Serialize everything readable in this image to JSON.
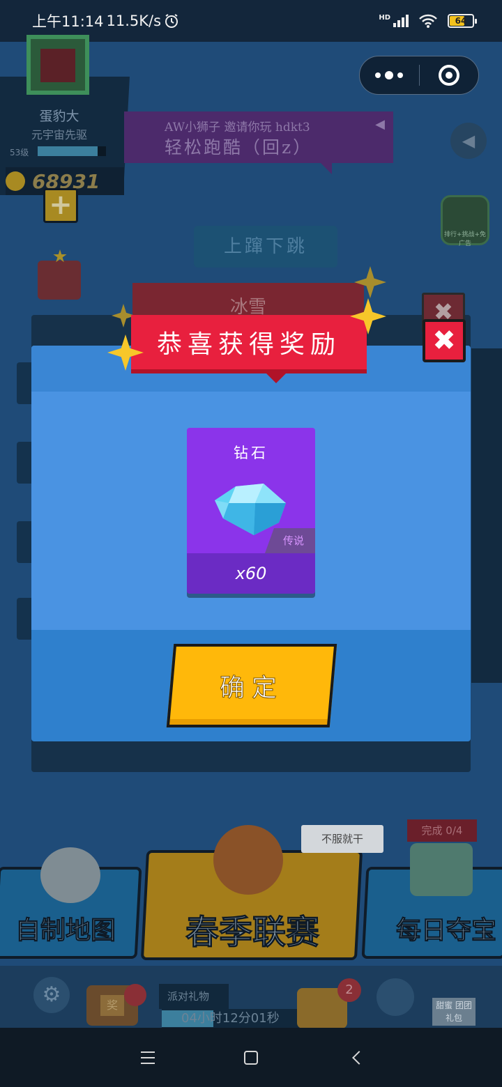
{
  "status_bar": {
    "time": "上午11:14",
    "net_speed": "11.5K/s",
    "hd_label": "HD",
    "battery": "64"
  },
  "background": {
    "player_name": "蛋豹大",
    "player_title": "元宇宙先驱",
    "level": "53级",
    "coins": "68931",
    "invite_line1": "AW小狮子 邀请你玩 hdkt3",
    "invite_line2": "轻松跑酷（回z）",
    "mode_name": "上蹿下跳",
    "event_badge": "排行+挑战+免广告",
    "red_bar_text": "冰雪",
    "card_map": "自制地图",
    "card_season": "春季联赛",
    "card_daily": "每日夺宝",
    "tooltip": "不服就干",
    "complete_tag": "完成 0/4",
    "gift_label": "派对礼物",
    "gift_timer": "04小时12分01秒",
    "chest_badge": "2",
    "sweet_label": "甜蜜 团团礼包",
    "tv_label": "奖"
  },
  "modal": {
    "title": "恭喜获得奖励",
    "close_symbol": "✖",
    "reward": {
      "name": "钻石",
      "rarity": "传说",
      "quantity": "x60"
    },
    "confirm_label": "确定"
  },
  "icons": {
    "close": "close-icon",
    "gem": "diamond-icon",
    "gear": "gear-icon",
    "speaker": "speaker-icon"
  }
}
